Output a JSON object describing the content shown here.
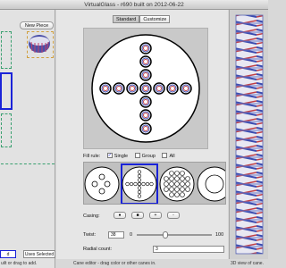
{
  "window": {
    "title": "VirtualGlass - r690 built on 2012-06-22"
  },
  "library": {
    "new_piece_label": "New Piece",
    "tab_selected_left": "d",
    "tab_uses_selected": "Uses Selected"
  },
  "editor": {
    "tabs": [
      "Standard",
      "Customize"
    ],
    "fill_rule_label": "Fill rule:",
    "fill_options": [
      "Single",
      "Group",
      "All"
    ],
    "fill_checked": [
      true,
      false,
      false
    ],
    "casing_label": "Casing:",
    "casing_plus": "+",
    "casing_minus": "-",
    "twist_label": "Twist:",
    "twist_value": "38",
    "twist_min": "0",
    "twist_max": "100",
    "twist_fraction": 0.38,
    "radial_label": "Radial count:",
    "radial_value": "3"
  },
  "status": {
    "left": "uilt or drag to add.",
    "center": "Cane editor - drag color or other canes in.",
    "right": "3D view of cane."
  },
  "colors": {
    "selection": "#1a23d8",
    "slot_border": "#3aa070",
    "cane_blue": "#3a4bb0",
    "cane_red": "#c04048"
  }
}
